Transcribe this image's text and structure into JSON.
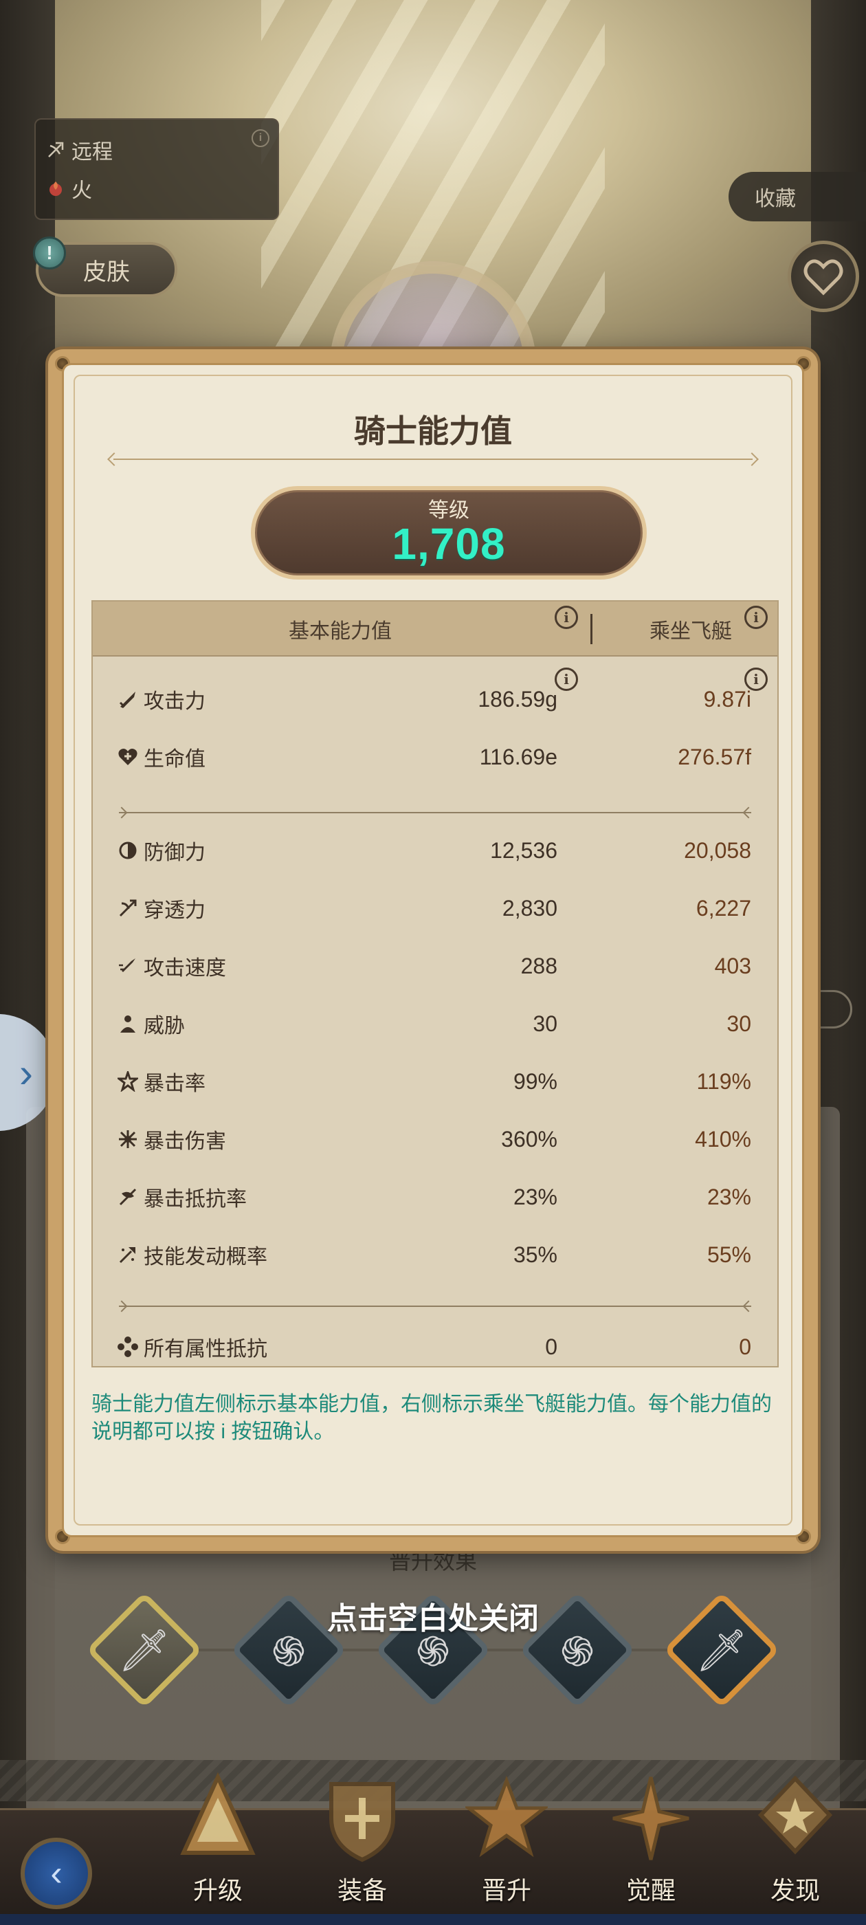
{
  "hero": {
    "attack_type": "远程",
    "element": "火",
    "skin_label": "皮肤",
    "skin_alert": "!",
    "favorite_label": "收藏"
  },
  "modal": {
    "title": "骑士能力值",
    "level_label": "等级",
    "level_value": "1,708",
    "headers": {
      "basic": "基本能力值",
      "ride": "乘坐飞艇"
    },
    "info_glyph": "i",
    "group1": [
      {
        "name": "攻击力",
        "icon": "sword-icon",
        "base": "186.59g",
        "ride": "9.87i"
      },
      {
        "name": "生命值",
        "icon": "heart-cross-icon",
        "base": "116.69e",
        "ride": "276.57f"
      }
    ],
    "group2": [
      {
        "name": "防御力",
        "icon": "shield-icon",
        "base": "12,536",
        "ride": "20,058"
      },
      {
        "name": "穿透力",
        "icon": "pierce-icon",
        "base": "2,830",
        "ride": "6,227"
      },
      {
        "name": "攻击速度",
        "icon": "speed-sword-icon",
        "base": "288",
        "ride": "403"
      },
      {
        "name": "威胁",
        "icon": "threat-icon",
        "base": "30",
        "ride": "30"
      },
      {
        "name": "暴击率",
        "icon": "crit-rate-icon",
        "base": "99%",
        "ride": "119%"
      },
      {
        "name": "暴击伤害",
        "icon": "crit-damage-icon",
        "base": "360%",
        "ride": "410%"
      },
      {
        "name": "暴击抵抗率",
        "icon": "crit-resist-icon",
        "base": "23%",
        "ride": "23%"
      },
      {
        "name": "技能发动概率",
        "icon": "skill-trigger-icon",
        "base": "35%",
        "ride": "55%"
      }
    ],
    "group3": [
      {
        "name": "所有属性抵抗",
        "icon": "all-resist-icon",
        "base": "0",
        "ride": "0"
      }
    ],
    "note": "骑士能力值左侧标示基本能力值，右侧标示乘坐飞艇能力值。每个能力值的说明都可以按 i 按钮确认。"
  },
  "promotion": {
    "title": "晋升效果",
    "close_hint": "点击空白处关闭"
  },
  "nav": {
    "items": [
      {
        "label": "升级",
        "icon": "upgrade-icon"
      },
      {
        "label": "装备",
        "icon": "equipment-icon"
      },
      {
        "label": "晋升",
        "icon": "promote-icon"
      },
      {
        "label": "觉醒",
        "icon": "awaken-icon"
      },
      {
        "label": "发现",
        "icon": "discover-icon"
      }
    ]
  },
  "colors": {
    "level_value": "#33f0c6",
    "note_text": "#1d8a7a",
    "ride_value": "#6a3e1f"
  }
}
